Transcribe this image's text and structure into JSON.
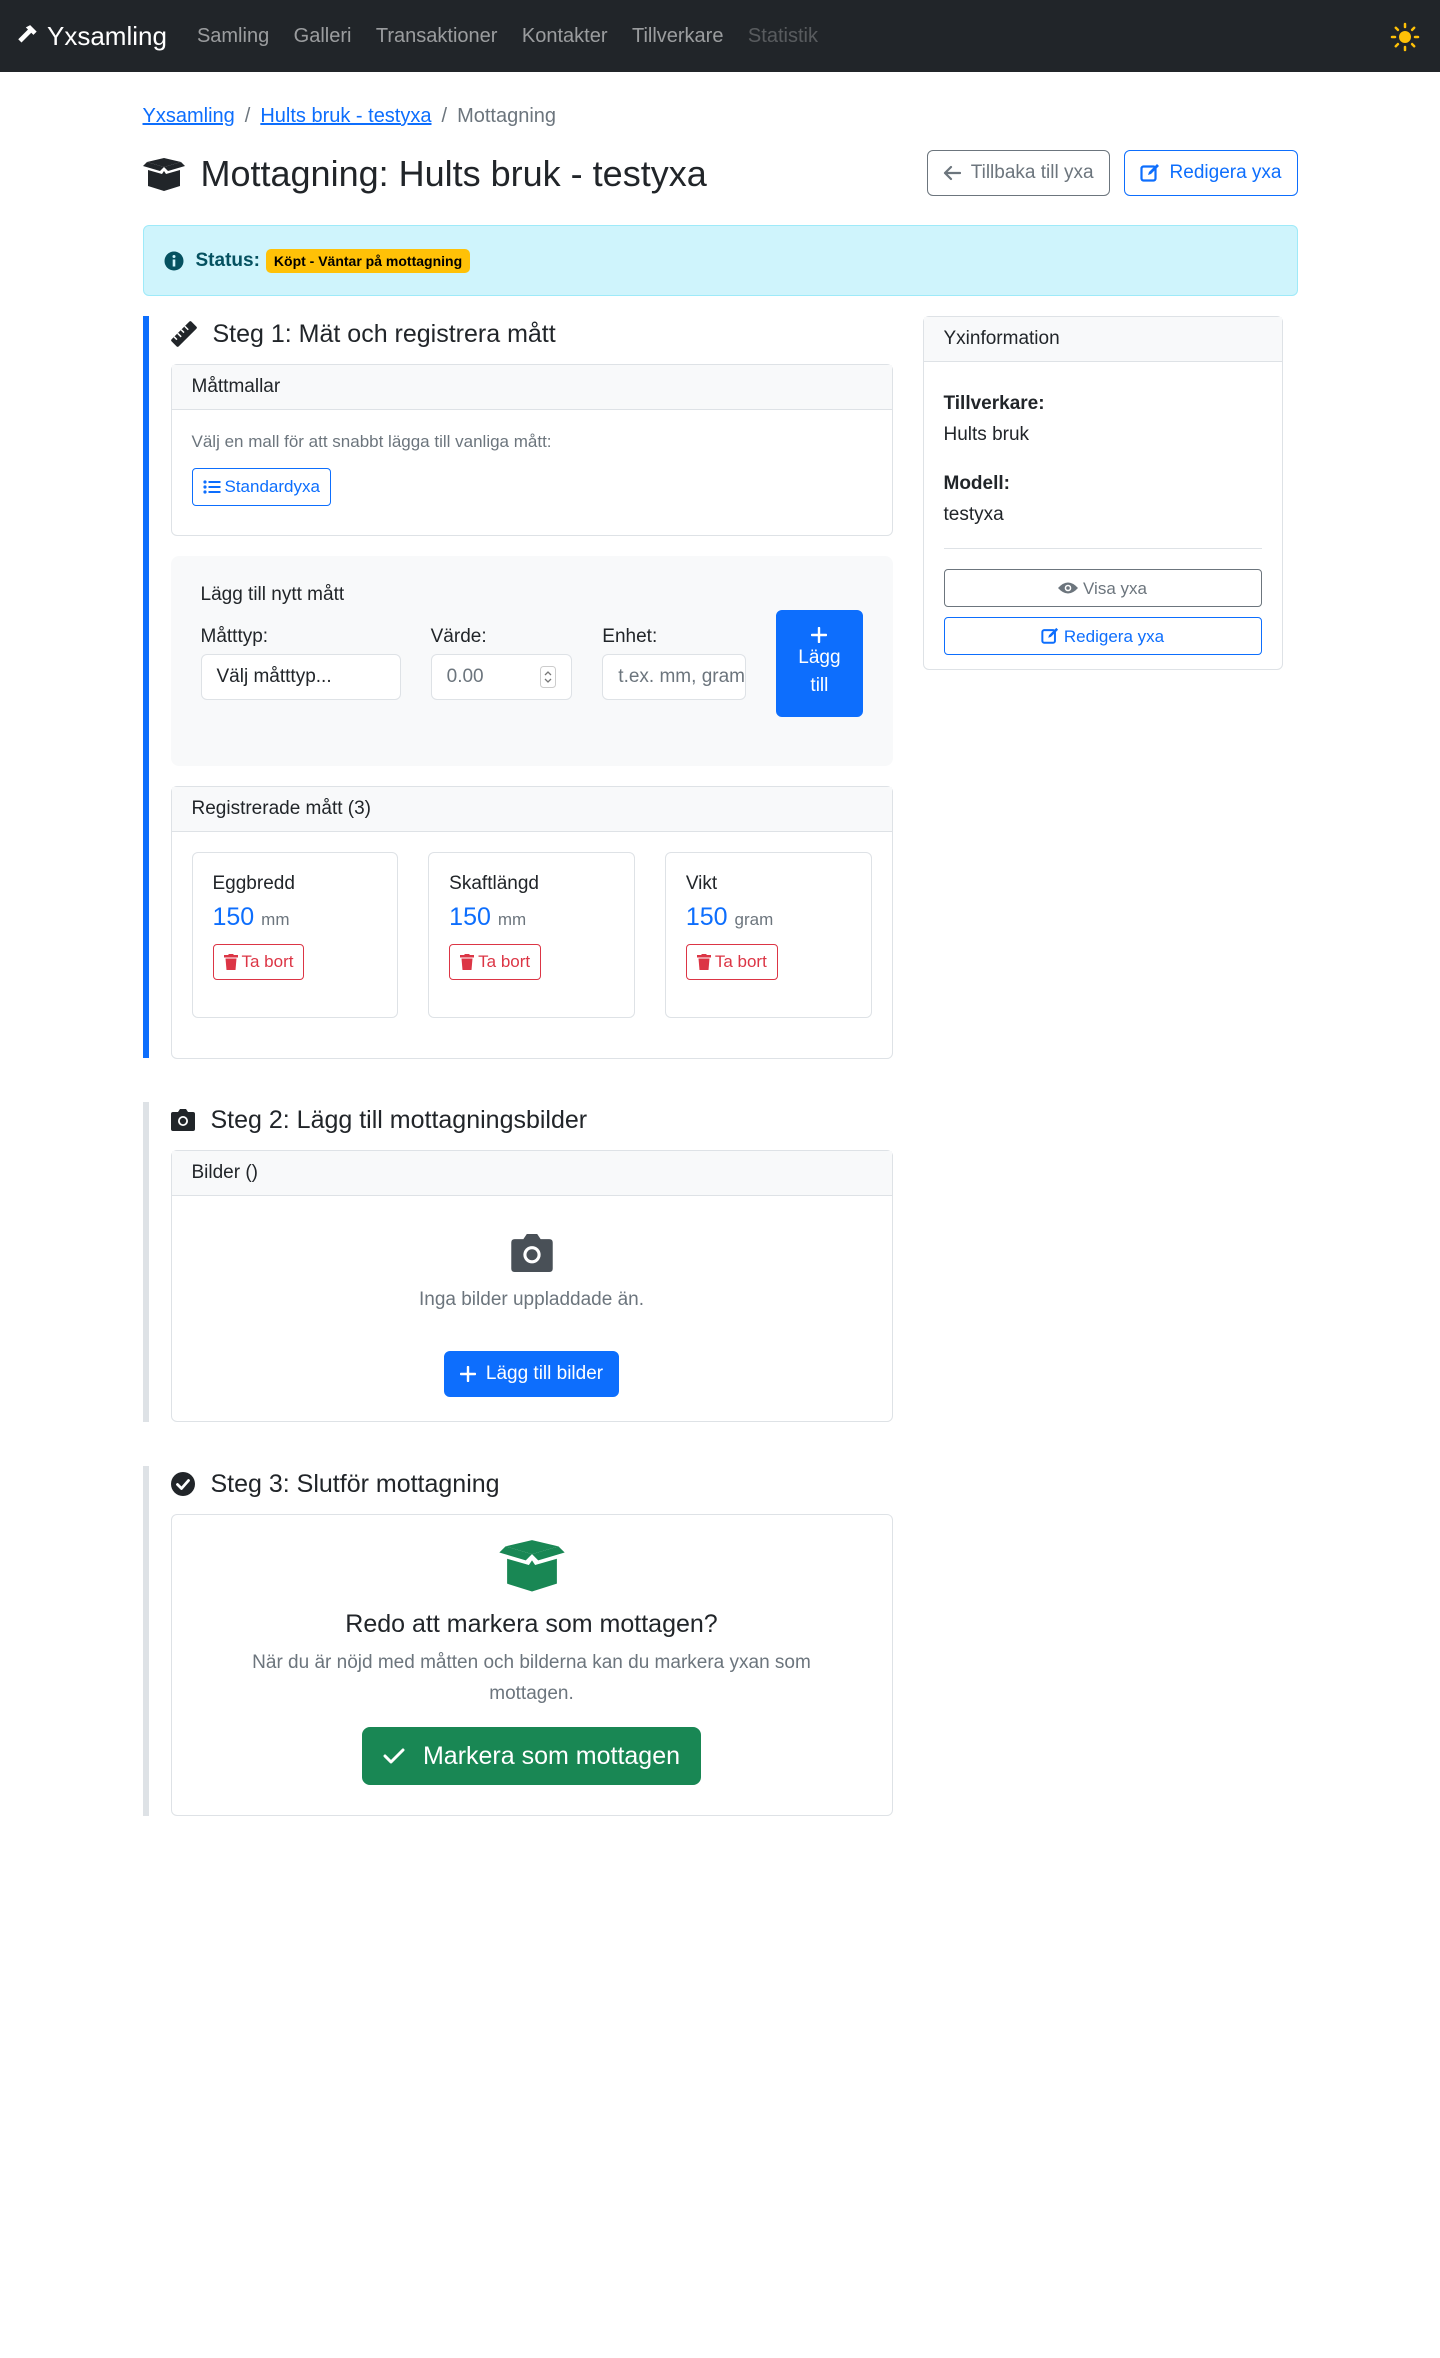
{
  "navbar": {
    "brand": "Yxsamling",
    "items": [
      {
        "label": "Samling",
        "disabled": false
      },
      {
        "label": "Galleri",
        "disabled": false
      },
      {
        "label": "Transaktioner",
        "disabled": false
      },
      {
        "label": "Kontakter",
        "disabled": false
      },
      {
        "label": "Tillverkare",
        "disabled": false
      },
      {
        "label": "Statistik",
        "disabled": true
      }
    ]
  },
  "breadcrumb": {
    "home": "Yxsamling",
    "axe": "Hults bruk - testyxa",
    "current": "Mottagning",
    "separator": "/"
  },
  "page": {
    "title": "Mottagning: Hults bruk - testyxa",
    "back_button": "Tillbaka till yxa",
    "edit_button": "Redigera yxa"
  },
  "status": {
    "label": "Status:",
    "badge": "Köpt - Väntar på mottagning"
  },
  "step1": {
    "title": "Steg 1: Mät och registrera mått",
    "templates": {
      "header": "Måttmallar",
      "hint": "Välj en mall för att snabbt lägga till vanliga mått:",
      "button": "Standardyxa"
    },
    "new_measure": {
      "title": "Lägg till nytt mått",
      "type_label": "Måtttyp:",
      "type_placeholder": "Välj måtttyp...",
      "value_label": "Värde:",
      "value_placeholder": "0.00",
      "unit_label": "Enhet:",
      "unit_placeholder": "t.ex. mm, gram",
      "add_button_1": "Lägg",
      "add_button_2": "till"
    },
    "registered": {
      "header": "Registrerade mått (3)",
      "delete_label": "Ta bort",
      "items": [
        {
          "name": "Eggbredd",
          "value": "150",
          "unit": "mm"
        },
        {
          "name": "Skaftlängd",
          "value": "150",
          "unit": "mm"
        },
        {
          "name": "Vikt",
          "value": "150",
          "unit": "gram"
        }
      ]
    }
  },
  "step2": {
    "title": "Steg 2: Lägg till mottagningsbilder",
    "header": "Bilder ()",
    "empty": "Inga bilder uppladdade än.",
    "button": "Lägg till bilder"
  },
  "step3": {
    "title": "Steg 3: Slutför mottagning",
    "heading": "Redo att markera som mottagen?",
    "text": "När du är nöjd med måtten och bilderna kan du markera yxan som mottagen.",
    "button": "Markera som mottagen"
  },
  "sidebar": {
    "header": "Yxinformation",
    "maker_label": "Tillverkare:",
    "maker": "Hults bruk",
    "model_label": "Modell:",
    "model": "testyxa",
    "view_button": "Visa yxa",
    "edit_button": "Redigera yxa"
  },
  "colors": {
    "primary": "#0d6efd",
    "success": "#198754",
    "danger": "#dc3545",
    "warning": "#ffc107",
    "info_bg": "#cff4fc"
  }
}
